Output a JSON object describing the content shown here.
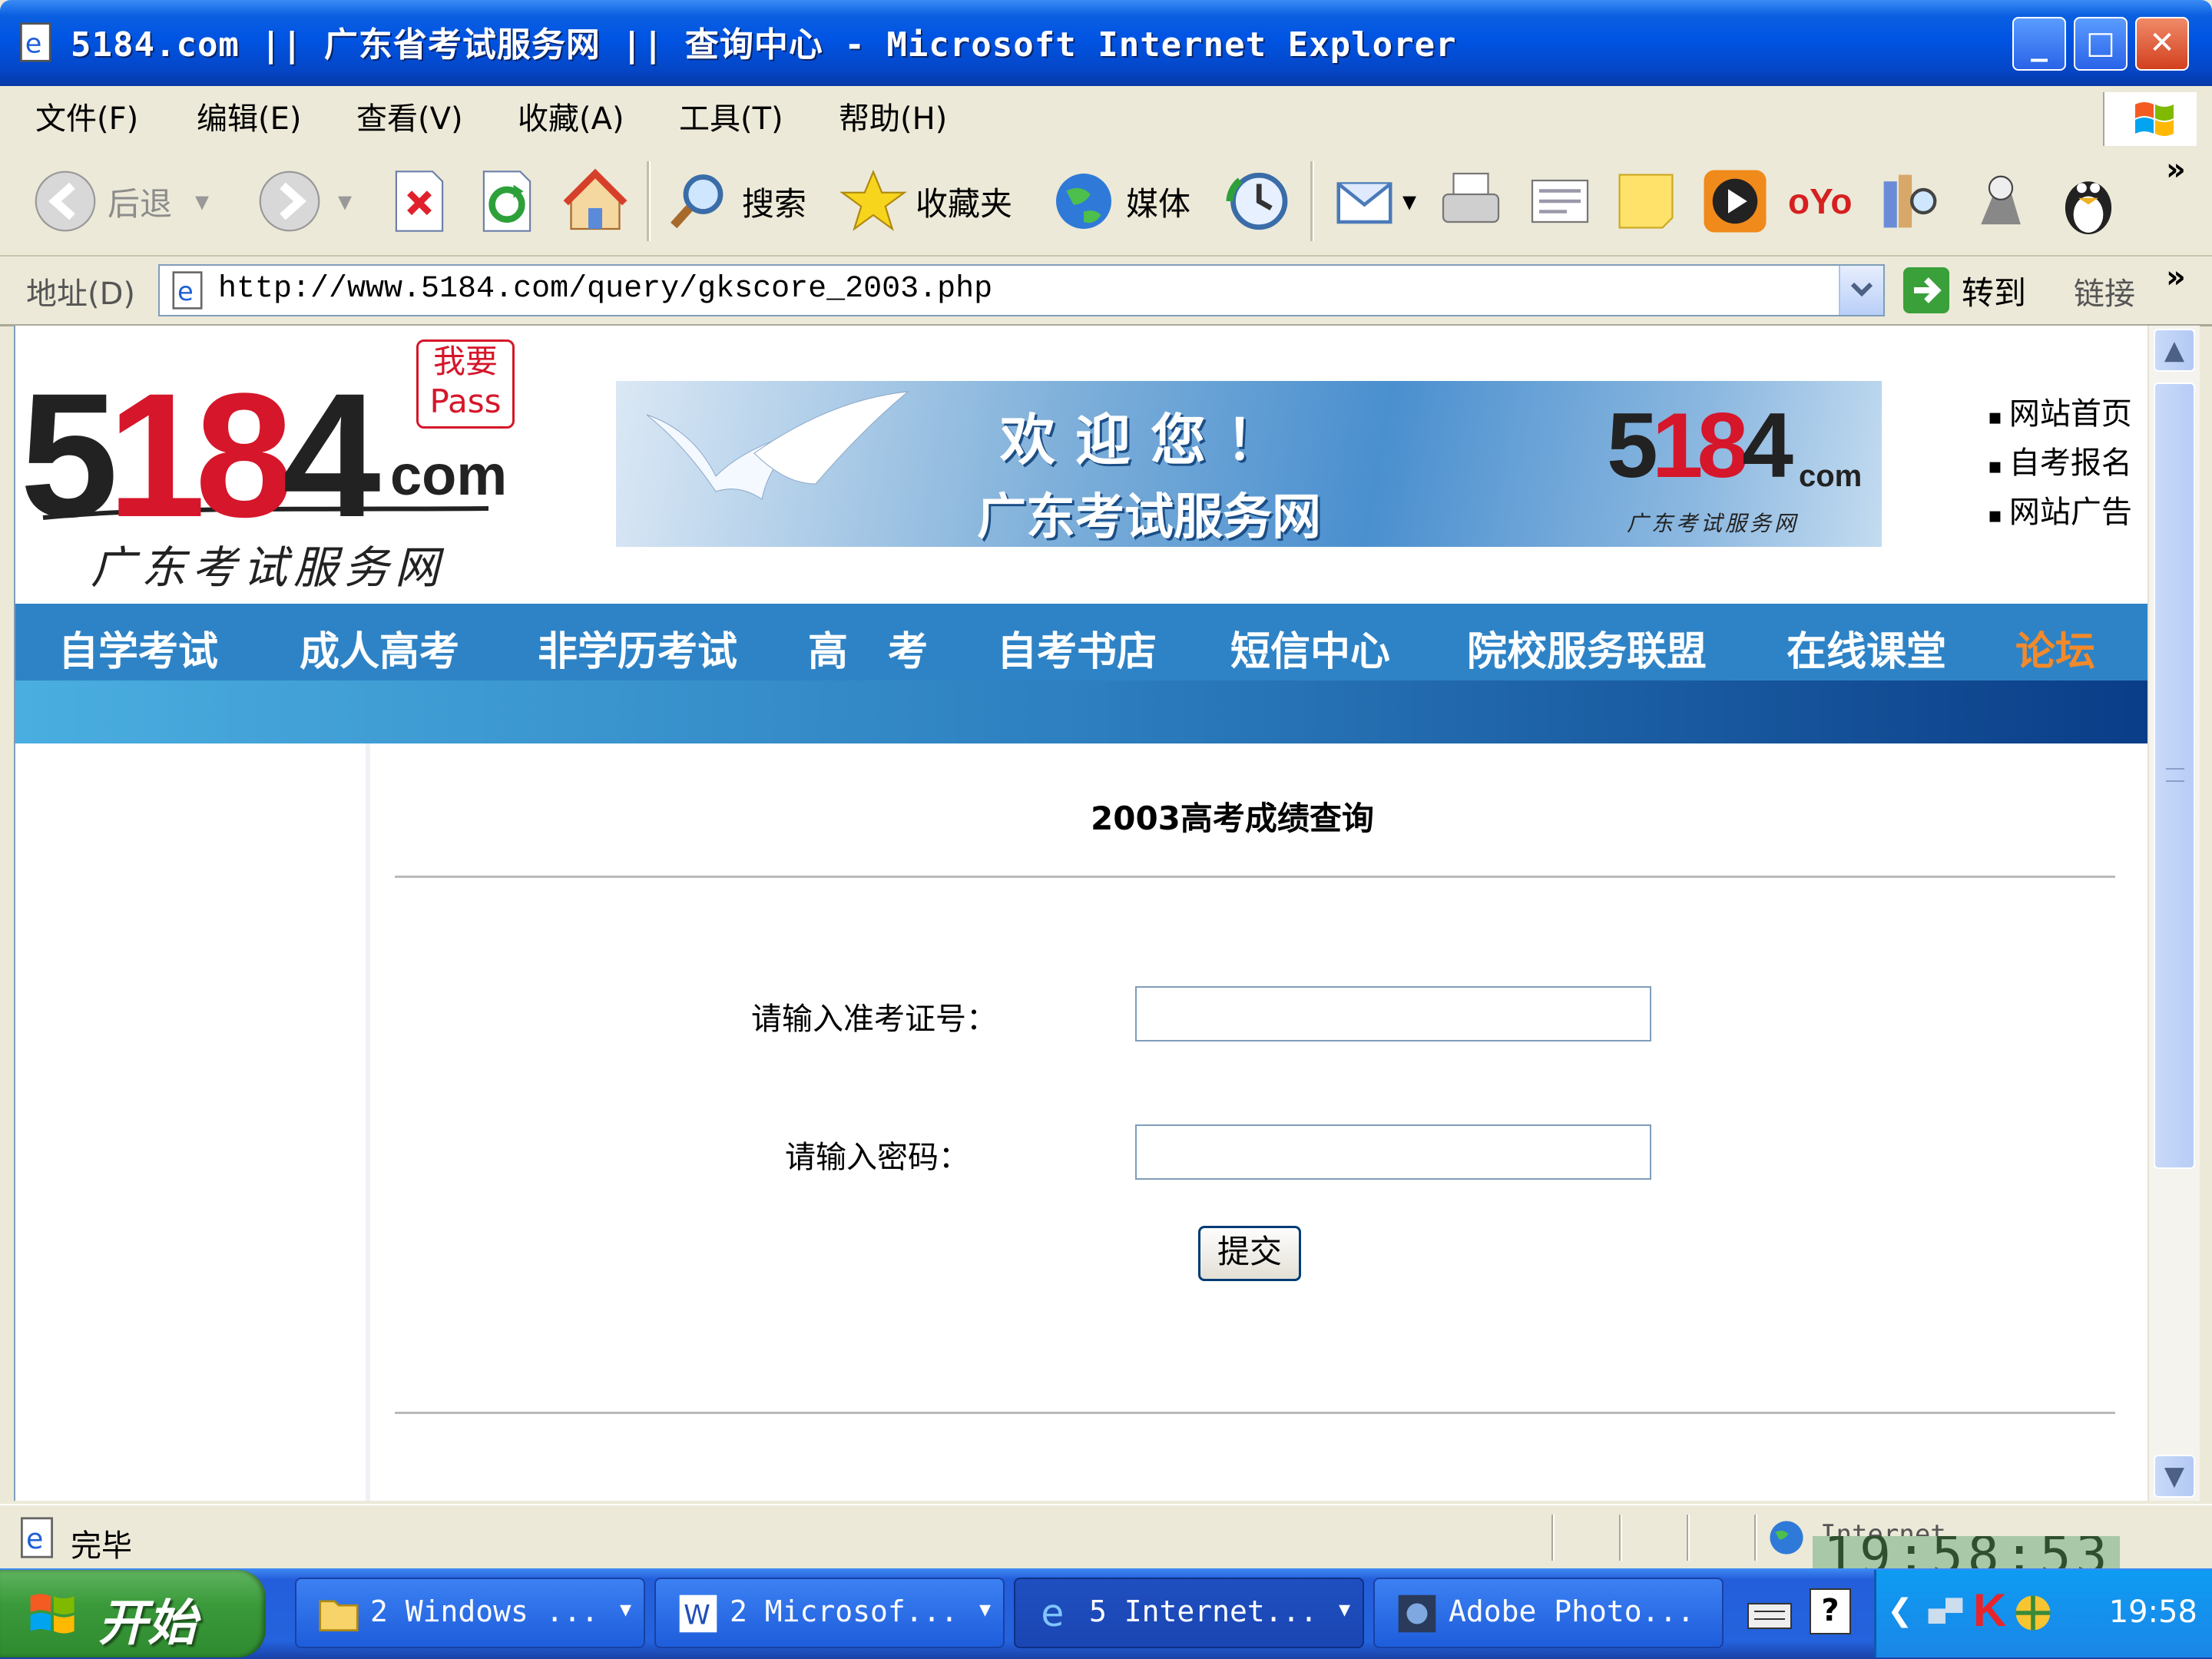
{
  "window": {
    "title": "5184.com || 广东省考试服务网 || 查询中心 - Microsoft Internet Explorer",
    "minimize": "_",
    "maximize": "□",
    "close": "✕"
  },
  "menu": [
    "文件(F)",
    "编辑(E)",
    "查看(V)",
    "收藏(A)",
    "工具(T)",
    "帮助(H)"
  ],
  "toolbar": {
    "back": "后退",
    "search": "搜索",
    "favorites": "收藏夹",
    "media": "媒体",
    "more": "»"
  },
  "address": {
    "label": "地址(D)",
    "url": "http://www.5184.com/query/gkscore_2003.php",
    "go": "转到",
    "links": "链接"
  },
  "site": {
    "logo_number": "5184",
    "logo_com": "com",
    "logo_tagline": "广东考试服务网",
    "logo_stamp": "我要Pass",
    "banner_welcome": "欢迎您！",
    "banner_name": "广东考试服务网",
    "top_links": [
      "网站首页",
      "自考报名",
      "网站广告"
    ],
    "nav": [
      "自学考试",
      "成人高考",
      "非学历考试",
      "高　考",
      "自考书店",
      "短信中心",
      "院校服务联盟",
      "在线课堂",
      "论坛"
    ]
  },
  "form": {
    "heading": "2003高考成绩查询",
    "ticket_label": "请输入准考证号：",
    "ticket_value": "",
    "password_label": "请输入密码：",
    "password_value": "",
    "submit": "提交"
  },
  "status": {
    "text": "完毕",
    "zone": "Internet",
    "overlay_clock": "19:58:53"
  },
  "taskbar": {
    "start": "开始",
    "tasks": [
      "2 Windows ...",
      "2 Microsof...",
      "5 Internet...",
      "Adobe Photo..."
    ],
    "clock": "19:58"
  },
  "colors": {
    "nav_bg": "#2e83c6",
    "nav_hot": "#f28a2b",
    "logo_red": "#d6162a",
    "titlebar": "#0054e3"
  }
}
